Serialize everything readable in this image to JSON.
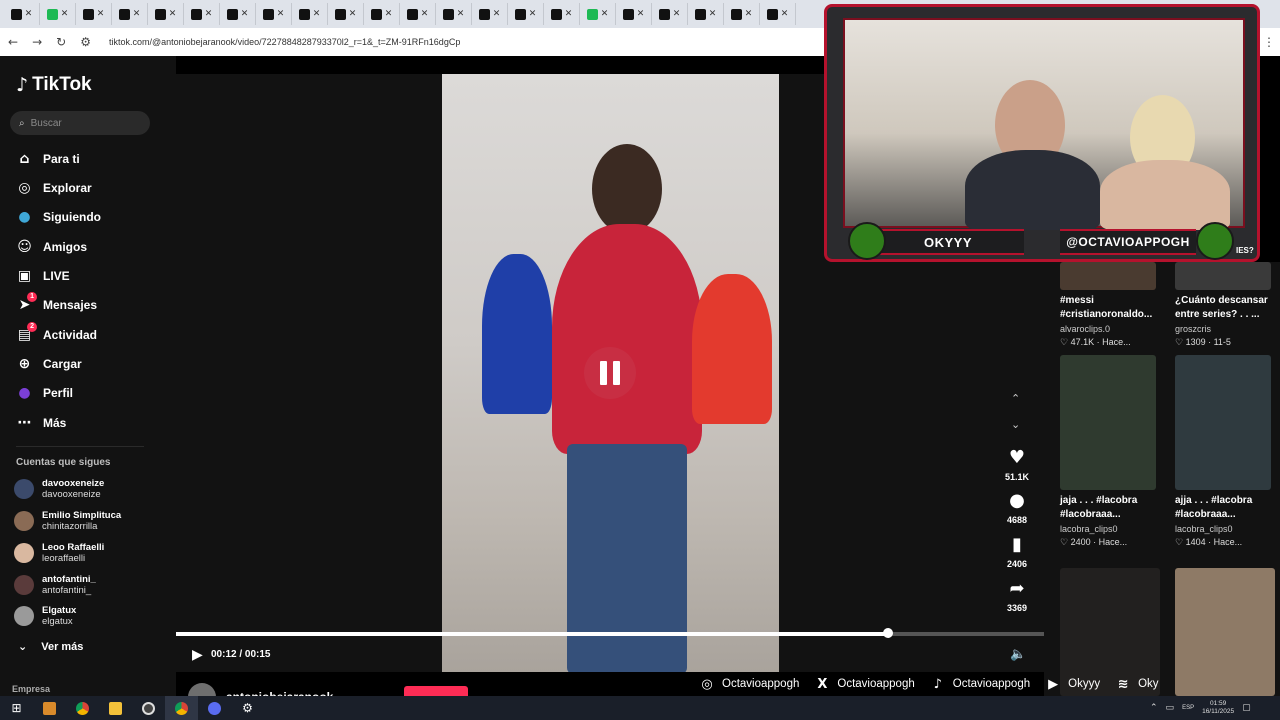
{
  "browser": {
    "url": "tiktok.com/@antoniobejaranook/video/7227884828793370l2_r=1&_t=ZM-91RFn16dgCp",
    "tab_count": 22
  },
  "sidebar": {
    "logo": "TikTok",
    "search_placeholder": "Buscar",
    "nav": [
      {
        "label": "Para ti",
        "icon": "home-icon"
      },
      {
        "label": "Explorar",
        "icon": "compass-icon"
      },
      {
        "label": "Siguiendo",
        "icon": "following-icon"
      },
      {
        "label": "Amigos",
        "icon": "friends-icon"
      },
      {
        "label": "LIVE",
        "icon": "live-icon"
      },
      {
        "label": "Mensajes",
        "icon": "messages-icon",
        "badge": "1"
      },
      {
        "label": "Actividad",
        "icon": "activity-icon",
        "badge": "2"
      },
      {
        "label": "Cargar",
        "icon": "upload-icon"
      },
      {
        "label": "Perfil",
        "icon": "profile-icon"
      },
      {
        "label": "Más",
        "icon": "more-icon"
      }
    ],
    "following_title": "Cuentas que sigues",
    "accounts": [
      {
        "name": "davooxeneize",
        "handle": "davooxeneize"
      },
      {
        "name": "Emilio Simplituca",
        "handle": "chinitazorrilla"
      },
      {
        "name": "Leoo Raffaelli",
        "handle": "leoraffaelli"
      },
      {
        "name": "antofantini_",
        "handle": "antofantini_"
      },
      {
        "name": "Elgatux",
        "handle": "elgatux"
      }
    ],
    "see_more": "Ver más",
    "footer": "Empresa"
  },
  "player": {
    "time": "00:12 / 00:15",
    "progress": 0.82,
    "author": "antoniobejaranook"
  },
  "actions": {
    "likes": "51.1K",
    "comments": "4688",
    "saves": "2406",
    "shares": "3369"
  },
  "webcam": {
    "left_name": "OKYYY",
    "right_name": "@OCTAVIOAPPOGH",
    "peek_text": "IES?"
  },
  "recommended": [
    {
      "title": "#messi #cristianoronaldo...",
      "user": "alvaroclips.0",
      "stats": "♡ 47.1K · Hace..."
    },
    {
      "title": "¿Cuánto descansar entre series? . . ...",
      "user": "groszcris",
      "stats": "♡ 1309 · 11-5"
    },
    {
      "title": "jaja . . . #lacobra #lacobraaa...",
      "user": "lacobra_clips0",
      "stats": "♡ 2400 · Hace..."
    },
    {
      "title": "ajja . . . #lacobra #lacobraaa...",
      "user": "lacobra_clips0",
      "stats": "♡ 1404 · Hace..."
    }
  ],
  "social": [
    {
      "icon": "instagram-icon",
      "label": "Octavioappogh"
    },
    {
      "icon": "x-icon",
      "label": "Octavioappogh"
    },
    {
      "icon": "tiktok-icon",
      "label": "Octavioappogh"
    },
    {
      "icon": "youtube-icon",
      "label": "Okyyy"
    },
    {
      "icon": "spotify-icon",
      "label": "Oky"
    }
  ],
  "taskbar": {
    "lang": "ESP",
    "time": "01:59",
    "date": "16/11/2025"
  },
  "colors": {
    "accent": "#fe2c55",
    "frame": "#b5122d",
    "background": "#121212"
  }
}
